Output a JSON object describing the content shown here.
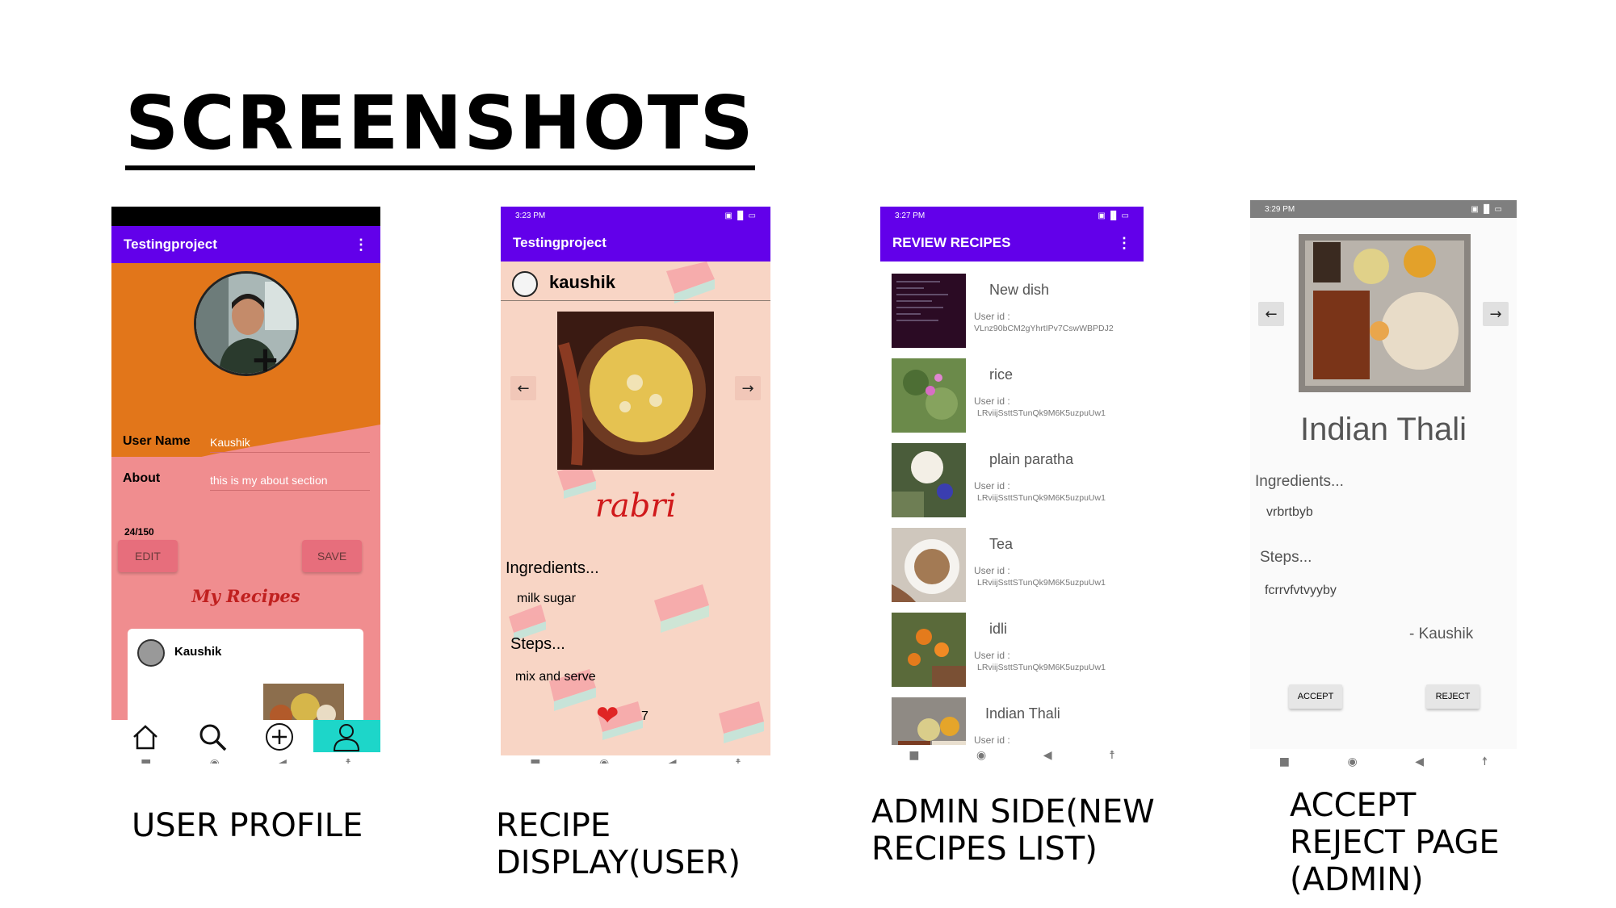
{
  "slide": {
    "title": "SCREENSHOTS",
    "captions": {
      "profile": [
        "USER PROFILE"
      ],
      "recipe": [
        "RECIPE",
        "DISPLAY(USER)"
      ],
      "admin": [
        "ADMIN SIDE(NEW",
        "RECIPES LIST)"
      ],
      "accept": [
        "ACCEPT",
        "REJECT PAGE",
        "(ADMIN)"
      ]
    }
  },
  "profile_screen": {
    "app_title": "Testingproject",
    "user_name_label": "User Name",
    "user_name_value": "Kaushik",
    "about_label": "About",
    "about_value": "this is my about section",
    "char_count": "24/150",
    "edit_label": "EDIT",
    "save_label": "SAVE",
    "my_recipes": "My Recipes",
    "card_author": "Kaushik",
    "nav_icons": [
      "home-icon",
      "search-icon",
      "add-circle-icon",
      "profile-icon"
    ],
    "colors": {
      "orange": "#e2761a",
      "pink": "#f08d8f",
      "teal": "#1dd6c9"
    }
  },
  "recipe_screen": {
    "status_time": "3:23 PM",
    "app_title": "Testingproject",
    "author": "kaushik",
    "recipe_name": "rabri",
    "ingredients_label": "Ingredients...",
    "ingredients": "milk sugar",
    "steps_label": "Steps...",
    "steps": "mix and serve",
    "likes": "7"
  },
  "review_screen": {
    "status_time": "3:27 PM",
    "app_title": "REVIEW RECIPES",
    "uid_label": "User id :",
    "items": [
      {
        "name": "New dish",
        "uid": "VLnz90bCM2gYhrtIPv7CswWBPDJ2"
      },
      {
        "name": "rice",
        "uid": "LRviijSsttSTunQk9M6K5uzpuUw1"
      },
      {
        "name": "plain paratha",
        "uid": "LRviijSsttSTunQk9M6K5uzpuUw1"
      },
      {
        "name": "Tea",
        "uid": "LRviijSsttSTunQk9M6K5uzpuUw1"
      },
      {
        "name": "idli",
        "uid": "LRviijSsttSTunQk9M6K5uzpuUw1"
      },
      {
        "name": "Indian Thali",
        "uid": ""
      }
    ]
  },
  "accept_screen": {
    "status_time": "3:29 PM",
    "recipe_name": "Indian Thali",
    "ingredients_label": "Ingredients...",
    "ingredients": "vrbrtbyb",
    "steps_label": "Steps...",
    "steps": "fcrrvfvtvyyby",
    "author": "- Kaushik",
    "accept_label": "ACCEPT",
    "reject_label": "REJECT"
  }
}
